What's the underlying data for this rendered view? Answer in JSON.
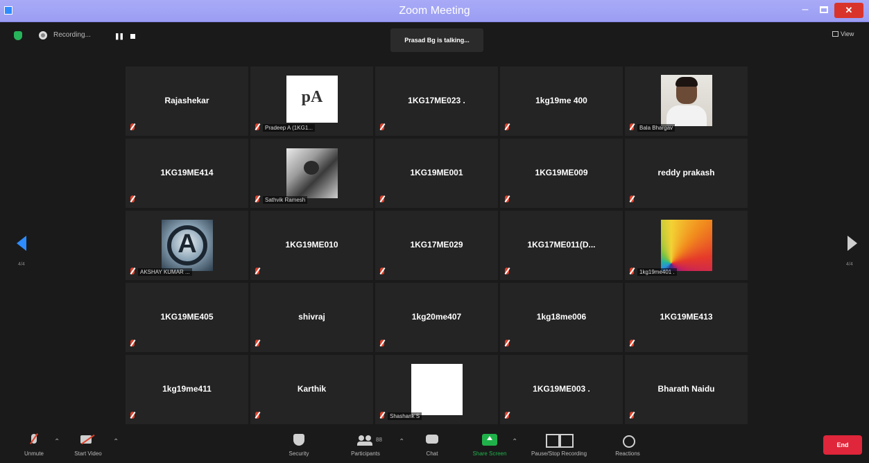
{
  "window": {
    "title": "Zoom Meeting"
  },
  "topbar": {
    "recording_label": "Recording...",
    "pause_glyph": "❚❚",
    "talking": "Prasad Bg is talking...",
    "view_label": "View"
  },
  "tiles": [
    {
      "name": "Rajashekar"
    },
    {
      "name": "",
      "label": "Pradeep A (1KG1...",
      "avatar": "pa-logo",
      "avatar_text": "pA"
    },
    {
      "name": "1KG17ME023 ."
    },
    {
      "name": "1kg19me 400"
    },
    {
      "name": "",
      "label": "Bala Bhargav",
      "avatar": "photo-person"
    },
    {
      "name": "1KG19ME414"
    },
    {
      "name": "",
      "label": "Sathvik Ramesh",
      "avatar": "photo-bw"
    },
    {
      "name": "1KG19ME001"
    },
    {
      "name": "1KG19ME009"
    },
    {
      "name": "reddy prakash"
    },
    {
      "name": "",
      "label": "AKSHAY KUMAR ...",
      "avatar": "avengers-logo",
      "avatar_text": "A"
    },
    {
      "name": "1KG19ME010"
    },
    {
      "name": "1KG17ME029"
    },
    {
      "name": "1KG17ME011(D..."
    },
    {
      "name": "",
      "label": "1kg19me401 .",
      "avatar": "color-fan"
    },
    {
      "name": "1KG19ME405"
    },
    {
      "name": "shivraj"
    },
    {
      "name": "1kg20me407"
    },
    {
      "name": "1kg18me006"
    },
    {
      "name": "1KG19ME413"
    },
    {
      "name": "1kg19me411"
    },
    {
      "name": "Karthik"
    },
    {
      "name": "",
      "label": "Shashank S",
      "avatar": "blank-white"
    },
    {
      "name": "1KG19ME003 ."
    },
    {
      "name": "Bharath Naidu"
    }
  ],
  "pagination": {
    "left": "4/4",
    "right": "4/4"
  },
  "toolbar": {
    "unmute": "Unmute",
    "start_video": "Start Video",
    "security": "Security",
    "participants": "Participants",
    "participants_count": "88",
    "chat": "Chat",
    "share_screen": "Share Screen",
    "pause_stop_recording": "Pause/Stop Recording",
    "reactions": "Reactions",
    "end": "End"
  },
  "colors": {
    "titlebar": "#9b9df3",
    "accent_blue": "#2d8cff",
    "share_green": "#20b24a",
    "end_red": "#e0263a",
    "mute_red": "#e0402a"
  }
}
